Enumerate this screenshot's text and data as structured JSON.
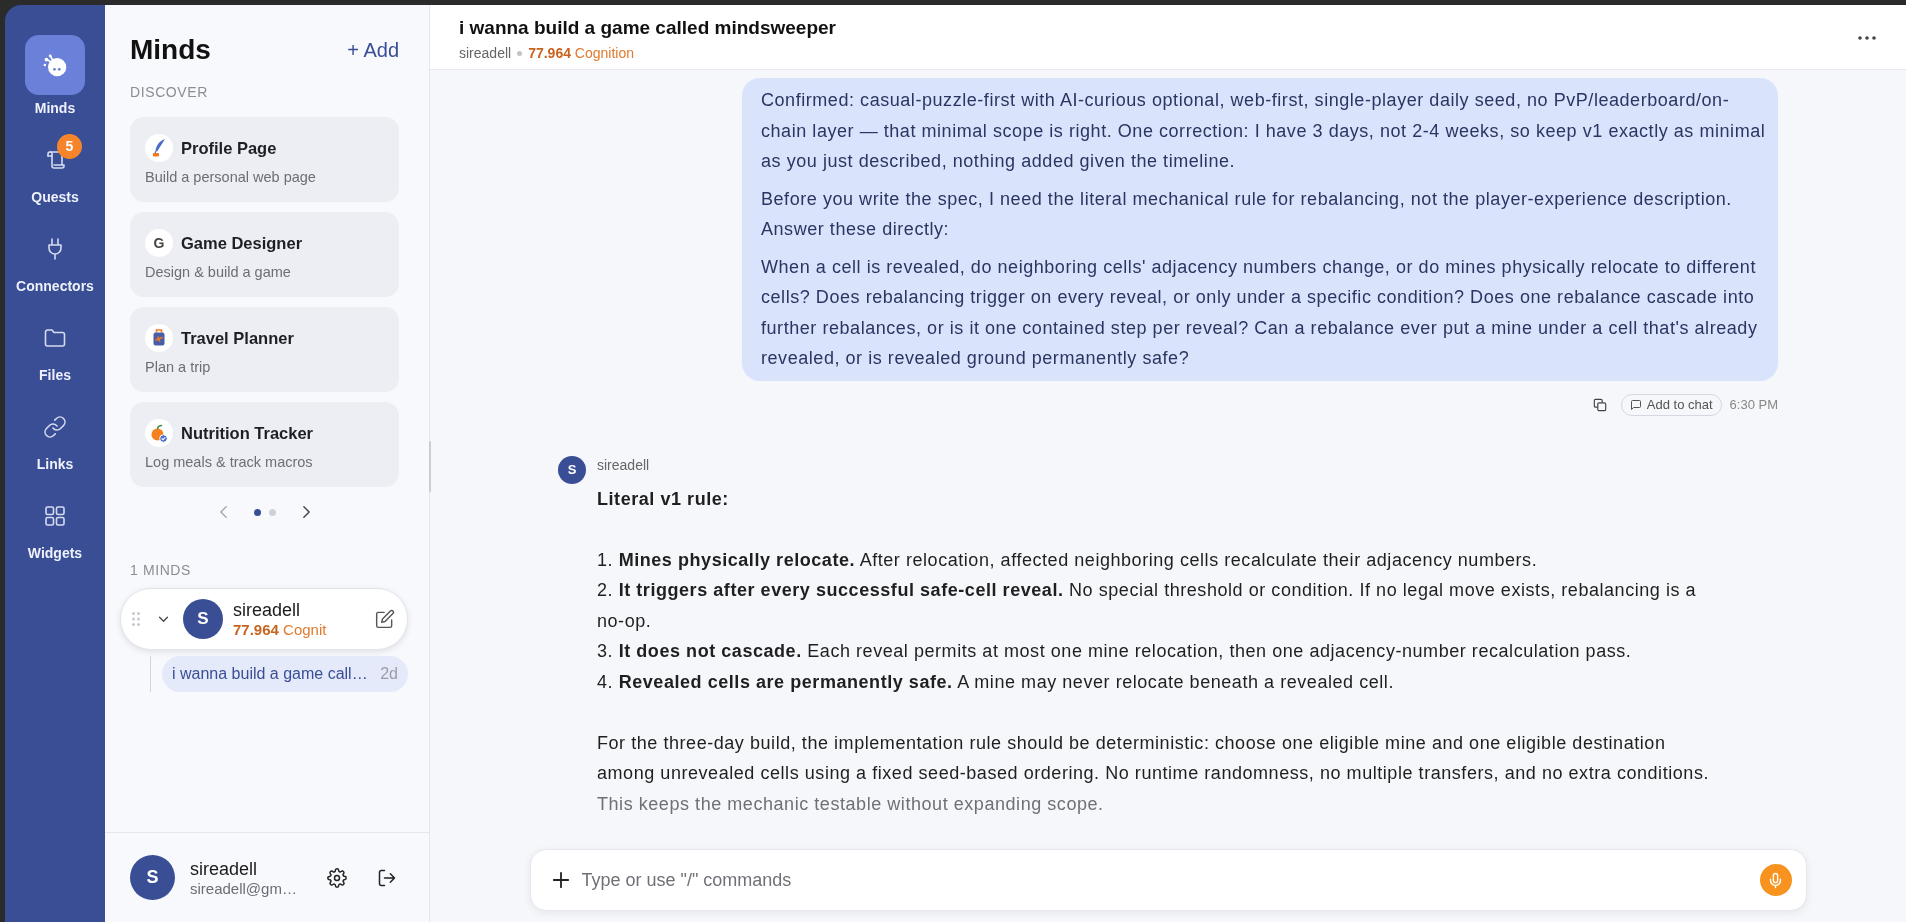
{
  "nav": [
    {
      "label": "Minds",
      "selected": true
    },
    {
      "label": "Quests",
      "selected": false,
      "badge": "5"
    },
    {
      "label": "Connectors",
      "selected": false
    },
    {
      "label": "Files",
      "selected": false
    },
    {
      "label": "Links",
      "selected": false
    },
    {
      "label": "Widgets",
      "selected": false
    }
  ],
  "sidebar": {
    "title": "Minds",
    "add_button": "+ Add",
    "discover_label": "DISCOVER",
    "cards": [
      {
        "title": "Profile Page",
        "subtitle": "Build a personal web page"
      },
      {
        "title": "Game Designer",
        "subtitle": "Design & build a game",
        "initial": "G"
      },
      {
        "title": "Travel Planner",
        "subtitle": "Plan a trip"
      },
      {
        "title": "Nutrition Tracker",
        "subtitle": "Log meals & track macros"
      }
    ],
    "pages": [
      {
        "selected": true
      },
      {
        "selected": false
      }
    ],
    "minds_label": "1 MINDS",
    "minds": [
      {
        "avatar": "S",
        "name": "sireadell",
        "score": "77.964",
        "unit": "Cognit",
        "selected": true,
        "expanded": true,
        "threads": [
          {
            "title": "i wanna build a game call…",
            "age": "2d",
            "selected": true
          }
        ]
      }
    ],
    "user": {
      "avatar": "S",
      "name": "sireadell",
      "email": "sireadell@gm…"
    }
  },
  "chat_header": {
    "title": "i wanna build a game called mindsweeper",
    "author": "sireadell",
    "score": "77.964",
    "unit": "Cognition"
  },
  "user_message": {
    "paragraphs": [
      "Confirmed: casual-puzzle-first with AI-curious optional, web-first, single-player daily seed, no PvP/leaderboard/on-chain layer — that minimal scope is right. One correction: I have 3 days, not 2-4 weeks, so keep v1 exactly as minimal as you just described, nothing added given the timeline.",
      "Before you write the spec, I need the literal mechanical rule for rebalancing, not the player-experience description. Answer these directly:",
      "When a cell is revealed, do neighboring cells' adjacency numbers change, or do mines physically relocate to different cells? Does rebalancing trigger on every reveal, or only under a specific condition? Does one rebalance cascade into further rebalances, or is it one contained step per reveal? Can a rebalance ever put a mine under a cell that's already revealed, or is revealed ground permanently safe?"
    ],
    "add_to_chat": "Add to chat",
    "time": "6:30 PM"
  },
  "assistant_message": {
    "avatar": "S",
    "author": "sireadell",
    "heading": "Literal v1 rule:",
    "rules": [
      "1. **Mines physically relocate.** After relocation, affected neighboring cells recalculate their adjacency numbers.",
      "2. **It triggers after every successful safe-cell reveal.** No special threshold or condition. If no legal move exists, rebalancing is a no-op.",
      "3. **It does not cascade.** Each reveal permits at most one mine relocation, then one adjacency-number recalculation pass.",
      "4. **Revealed cells are permanently safe.** A mine may never relocate beneath a revealed cell."
    ],
    "paragraphs": [
      {
        "text": "For the three-day build, the implementation rule should be deterministic: choose one eligible mine and one eligible destination among unrevealed cells using a fixed seed-based ordering. No runtime randomness, no multiple transfers, and no extra conditions.",
        "faded": false
      },
      {
        "text": "This keeps the mechanic testable without expanding scope.",
        "faded": true
      }
    ]
  },
  "composer": {
    "placeholder": "Type or use \"/\" commands"
  }
}
